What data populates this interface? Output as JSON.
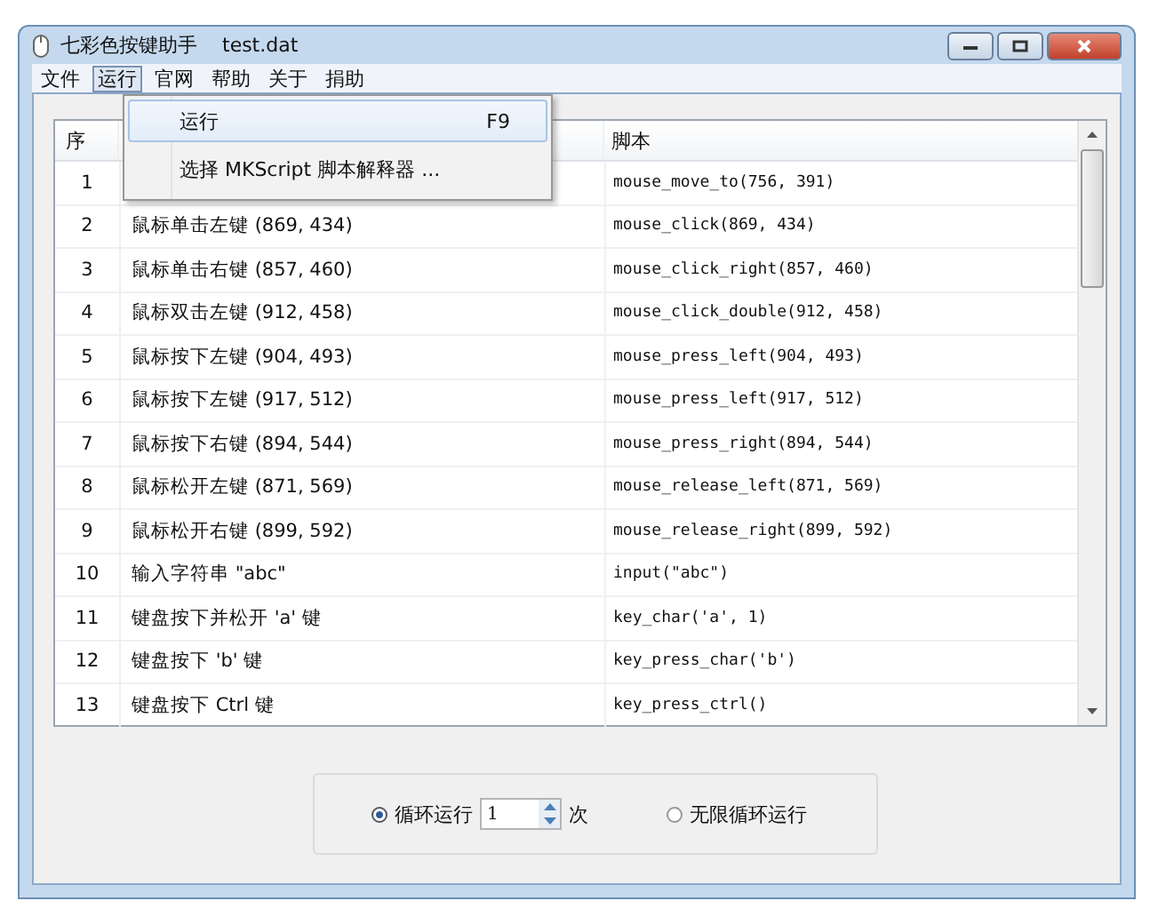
{
  "window": {
    "title": "七彩色按键助手",
    "file": "test.dat"
  },
  "menu_bar": [
    {
      "label": "文件",
      "selected": false
    },
    {
      "label": "运行",
      "selected": true
    },
    {
      "label": "官网",
      "selected": false
    },
    {
      "label": "帮助",
      "selected": false
    },
    {
      "label": "关于",
      "selected": false
    },
    {
      "label": "捐助",
      "selected": false
    }
  ],
  "dropdown": [
    {
      "label": "运行",
      "shortcut": "F9",
      "selected": true
    },
    {
      "label": "选择 MKScript 脚本解释器 ...",
      "selected": false
    }
  ],
  "table": {
    "columns": [
      "序",
      "脚本"
    ],
    "rows": [
      {
        "index": "1",
        "script": "mouse_move_to(756, 391)"
      },
      {
        "index": "2",
        "action": "鼠标单击左键 (869, 434)",
        "script": "mouse_click(869, 434)"
      },
      {
        "index": "3",
        "action": "鼠标单击右键 (857, 460)",
        "script": "mouse_click_right(857, 460)"
      },
      {
        "index": "4",
        "action": "鼠标双击左键 (912, 458)",
        "script": "mouse_click_double(912, 458)"
      },
      {
        "index": "5",
        "action": "鼠标按下左键 (904, 493)",
        "script": "mouse_press_left(904, 493)"
      },
      {
        "index": "6",
        "action": "鼠标按下左键 (917, 512)",
        "script": "mouse_press_left(917, 512)"
      },
      {
        "index": "7",
        "action": "鼠标按下右键 (894, 544)",
        "script": "mouse_press_right(894, 544)"
      },
      {
        "index": "8",
        "action": "鼠标松开左键 (871, 569)",
        "script": "mouse_release_left(871, 569)"
      },
      {
        "index": "9",
        "action": "鼠标松开右键 (899, 592)",
        "script": "mouse_release_right(899, 592)"
      },
      {
        "index": "10",
        "action": "输入字符串 \"abc\"",
        "script": "input(\"abc\")"
      },
      {
        "index": "11",
        "action": "键盘按下并松开 'a' 键",
        "script": "key_char('a', 1)"
      },
      {
        "index": "12",
        "action": "键盘按下 'b' 键",
        "script": "key_press_char('b')"
      },
      {
        "index": "13",
        "action": "键盘按下 Ctrl 键",
        "script": "key_press_ctrl()"
      }
    ]
  },
  "loop_options": [
    {
      "label": "循环运行",
      "selected": true,
      "count": "1",
      "unit": "次"
    },
    {
      "label": "无限循环运行",
      "selected": false
    }
  ]
}
